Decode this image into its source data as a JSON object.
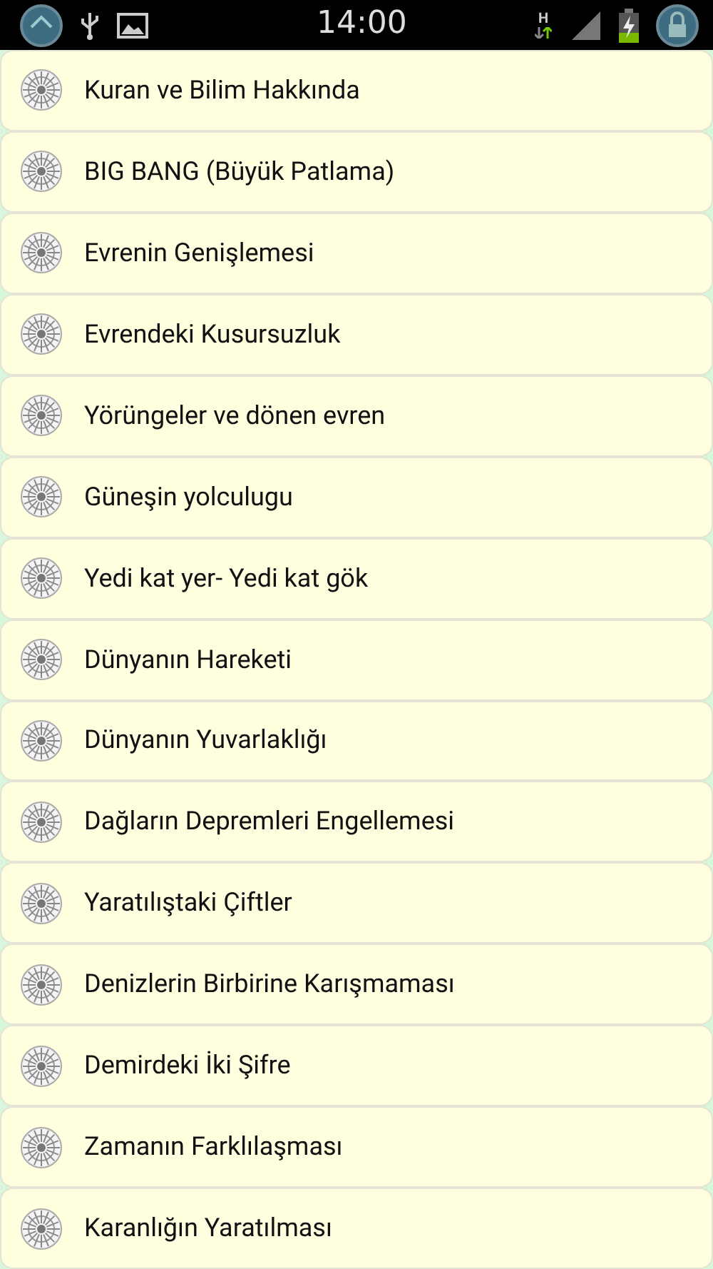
{
  "status_bar": {
    "time": "14:00",
    "network": "H"
  },
  "items": [
    {
      "title": "Kuran ve Bilim Hakkında"
    },
    {
      "title": "BIG BANG (Büyük Patlama)"
    },
    {
      "title": "Evrenin Genişlemesi"
    },
    {
      "title": "Evrendeki Kusursuzluk"
    },
    {
      "title": "Yörüngeler ve dönen evren"
    },
    {
      "title": "Güneşin yolculugu"
    },
    {
      "title": "Yedi kat yer- Yedi kat gök"
    },
    {
      "title": "Dünyanın Hareketi"
    },
    {
      "title": "Dünyanın Yuvarlaklığı"
    },
    {
      "title": "Dağların Depremleri Engellemesi"
    },
    {
      "title": "Yaratılıştaki Çiftler"
    },
    {
      "title": "Denizlerin Birbirine Karışmaması"
    },
    {
      "title": "Demirdeki İki Şifre"
    },
    {
      "title": "Zamanın Farklılaşması"
    },
    {
      "title": "Karanlığın Yaratılması"
    }
  ]
}
